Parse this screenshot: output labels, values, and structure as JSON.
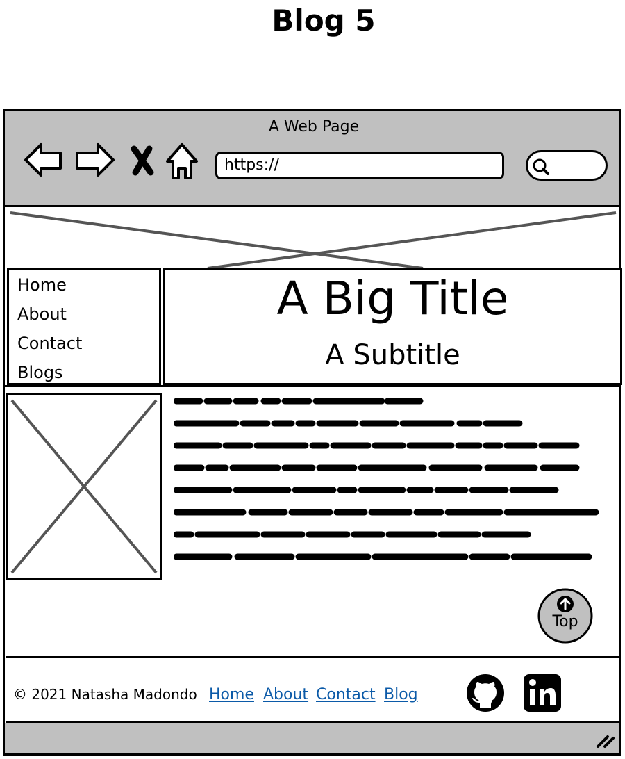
{
  "heading": "Blog 5",
  "browser": {
    "window_title": "A Web Page",
    "url": "https://",
    "icons": [
      "back-arrow-icon",
      "forward-arrow-icon",
      "close-x-icon",
      "home-icon",
      "search-icon"
    ]
  },
  "sidebar": {
    "items": [
      {
        "label": "Home"
      },
      {
        "label": "About"
      },
      {
        "label": "Contact"
      },
      {
        "label": "Blogs"
      }
    ]
  },
  "hero": {
    "title": "A Big Title",
    "subtitle": "A Subtitle"
  },
  "top_button": {
    "label": "Top",
    "icon": "arrow-up-circle-icon"
  },
  "footer": {
    "copyright": "© 2021 Natasha Madondo",
    "links": [
      {
        "label": "Home"
      },
      {
        "label": "About"
      },
      {
        "label": "Contact"
      },
      {
        "label": "Blog"
      }
    ],
    "social_icons": [
      "github-icon",
      "linkedin-icon"
    ],
    "link_color": "#0b5aa8"
  },
  "colors": {
    "chrome": "#c0c0c0",
    "placeholder_x": "#555555"
  }
}
